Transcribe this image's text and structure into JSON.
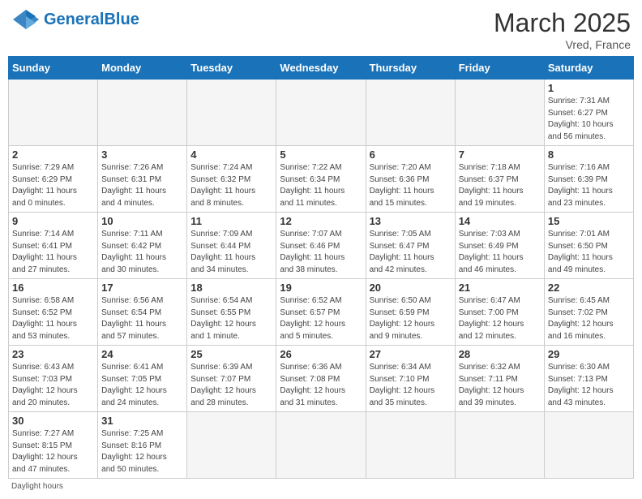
{
  "header": {
    "logo_general": "General",
    "logo_blue": "Blue",
    "title": "March 2025",
    "subtitle": "Vred, France"
  },
  "weekdays": [
    "Sunday",
    "Monday",
    "Tuesday",
    "Wednesday",
    "Thursday",
    "Friday",
    "Saturday"
  ],
  "footer": "Daylight hours",
  "weeks": [
    [
      {
        "day": "",
        "info": ""
      },
      {
        "day": "",
        "info": ""
      },
      {
        "day": "",
        "info": ""
      },
      {
        "day": "",
        "info": ""
      },
      {
        "day": "",
        "info": ""
      },
      {
        "day": "",
        "info": ""
      },
      {
        "day": "1",
        "info": "Sunrise: 7:31 AM\nSunset: 6:27 PM\nDaylight: 10 hours\nand 56 minutes."
      }
    ],
    [
      {
        "day": "2",
        "info": "Sunrise: 7:29 AM\nSunset: 6:29 PM\nDaylight: 11 hours\nand 0 minutes."
      },
      {
        "day": "3",
        "info": "Sunrise: 7:26 AM\nSunset: 6:31 PM\nDaylight: 11 hours\nand 4 minutes."
      },
      {
        "day": "4",
        "info": "Sunrise: 7:24 AM\nSunset: 6:32 PM\nDaylight: 11 hours\nand 8 minutes."
      },
      {
        "day": "5",
        "info": "Sunrise: 7:22 AM\nSunset: 6:34 PM\nDaylight: 11 hours\nand 11 minutes."
      },
      {
        "day": "6",
        "info": "Sunrise: 7:20 AM\nSunset: 6:36 PM\nDaylight: 11 hours\nand 15 minutes."
      },
      {
        "day": "7",
        "info": "Sunrise: 7:18 AM\nSunset: 6:37 PM\nDaylight: 11 hours\nand 19 minutes."
      },
      {
        "day": "8",
        "info": "Sunrise: 7:16 AM\nSunset: 6:39 PM\nDaylight: 11 hours\nand 23 minutes."
      }
    ],
    [
      {
        "day": "9",
        "info": "Sunrise: 7:14 AM\nSunset: 6:41 PM\nDaylight: 11 hours\nand 27 minutes."
      },
      {
        "day": "10",
        "info": "Sunrise: 7:11 AM\nSunset: 6:42 PM\nDaylight: 11 hours\nand 30 minutes."
      },
      {
        "day": "11",
        "info": "Sunrise: 7:09 AM\nSunset: 6:44 PM\nDaylight: 11 hours\nand 34 minutes."
      },
      {
        "day": "12",
        "info": "Sunrise: 7:07 AM\nSunset: 6:46 PM\nDaylight: 11 hours\nand 38 minutes."
      },
      {
        "day": "13",
        "info": "Sunrise: 7:05 AM\nSunset: 6:47 PM\nDaylight: 11 hours\nand 42 minutes."
      },
      {
        "day": "14",
        "info": "Sunrise: 7:03 AM\nSunset: 6:49 PM\nDaylight: 11 hours\nand 46 minutes."
      },
      {
        "day": "15",
        "info": "Sunrise: 7:01 AM\nSunset: 6:50 PM\nDaylight: 11 hours\nand 49 minutes."
      }
    ],
    [
      {
        "day": "16",
        "info": "Sunrise: 6:58 AM\nSunset: 6:52 PM\nDaylight: 11 hours\nand 53 minutes."
      },
      {
        "day": "17",
        "info": "Sunrise: 6:56 AM\nSunset: 6:54 PM\nDaylight: 11 hours\nand 57 minutes."
      },
      {
        "day": "18",
        "info": "Sunrise: 6:54 AM\nSunset: 6:55 PM\nDaylight: 12 hours\nand 1 minute."
      },
      {
        "day": "19",
        "info": "Sunrise: 6:52 AM\nSunset: 6:57 PM\nDaylight: 12 hours\nand 5 minutes."
      },
      {
        "day": "20",
        "info": "Sunrise: 6:50 AM\nSunset: 6:59 PM\nDaylight: 12 hours\nand 9 minutes."
      },
      {
        "day": "21",
        "info": "Sunrise: 6:47 AM\nSunset: 7:00 PM\nDaylight: 12 hours\nand 12 minutes."
      },
      {
        "day": "22",
        "info": "Sunrise: 6:45 AM\nSunset: 7:02 PM\nDaylight: 12 hours\nand 16 minutes."
      }
    ],
    [
      {
        "day": "23",
        "info": "Sunrise: 6:43 AM\nSunset: 7:03 PM\nDaylight: 12 hours\nand 20 minutes."
      },
      {
        "day": "24",
        "info": "Sunrise: 6:41 AM\nSunset: 7:05 PM\nDaylight: 12 hours\nand 24 minutes."
      },
      {
        "day": "25",
        "info": "Sunrise: 6:39 AM\nSunset: 7:07 PM\nDaylight: 12 hours\nand 28 minutes."
      },
      {
        "day": "26",
        "info": "Sunrise: 6:36 AM\nSunset: 7:08 PM\nDaylight: 12 hours\nand 31 minutes."
      },
      {
        "day": "27",
        "info": "Sunrise: 6:34 AM\nSunset: 7:10 PM\nDaylight: 12 hours\nand 35 minutes."
      },
      {
        "day": "28",
        "info": "Sunrise: 6:32 AM\nSunset: 7:11 PM\nDaylight: 12 hours\nand 39 minutes."
      },
      {
        "day": "29",
        "info": "Sunrise: 6:30 AM\nSunset: 7:13 PM\nDaylight: 12 hours\nand 43 minutes."
      }
    ],
    [
      {
        "day": "30",
        "info": "Sunrise: 7:27 AM\nSunset: 8:15 PM\nDaylight: 12 hours\nand 47 minutes."
      },
      {
        "day": "31",
        "info": "Sunrise: 7:25 AM\nSunset: 8:16 PM\nDaylight: 12 hours\nand 50 minutes."
      },
      {
        "day": "",
        "info": ""
      },
      {
        "day": "",
        "info": ""
      },
      {
        "day": "",
        "info": ""
      },
      {
        "day": "",
        "info": ""
      },
      {
        "day": "",
        "info": ""
      }
    ]
  ]
}
